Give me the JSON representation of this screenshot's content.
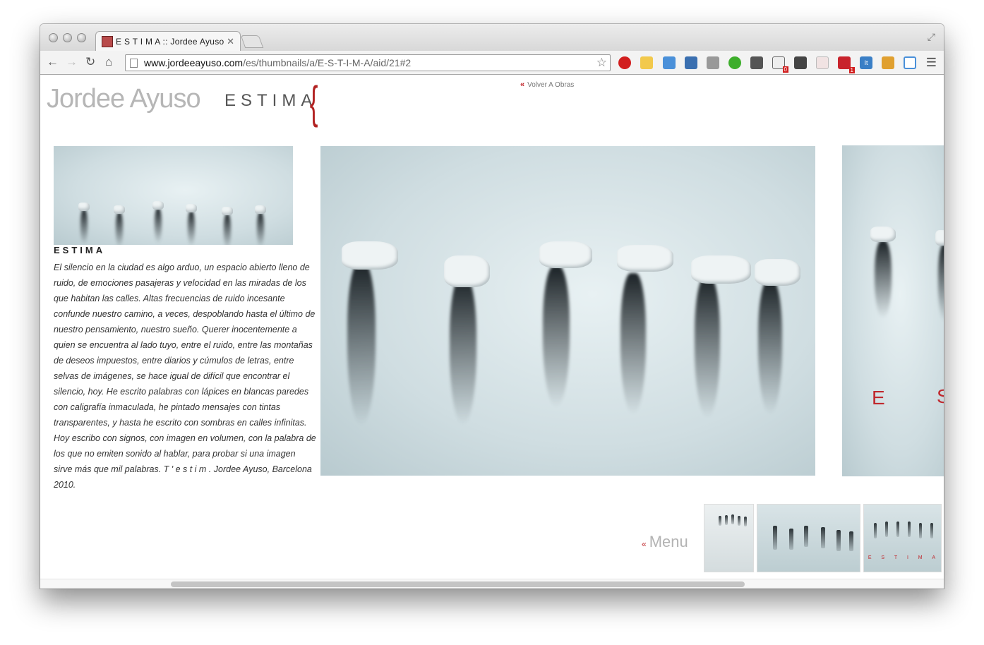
{
  "browser": {
    "tab_title": "E S T I M A :: Jordee Ayuso ::",
    "url_host": "www.jordeeayuso.com",
    "url_path": "/es/thumbnails/a/E-S-T-I-M-A/aid/21#2",
    "extension_badges": {
      "badge_a": "0",
      "badge_b": "1"
    },
    "extension_label_it": "It"
  },
  "site": {
    "logo": "Jordee Ayuso",
    "section_title": "ESTIMA",
    "back_link": "Volver A Obras",
    "menu_link": "Menu"
  },
  "artwork": {
    "title": "ESTIMA",
    "description": "El silencio en la ciudad es algo arduo, un espacio abierto lleno de ruido, de emociones pasajeras y velocidad en las miradas de los que habitan las calles. Altas frecuencias de ruido incesante confunde nuestro camino, a veces, despoblando hasta el último de nuestro pensamiento, nuestro sueño. Querer inocentemente a quien se encuentra al lado tuyo, entre el ruido, entre las montañas de deseos impuestos, entre diarios y cúmulos de letras, entre selvas de imágenes, se hace igual de difícil que encontrar el silencio, hoy. He escrito palabras con lápices en blancas paredes con caligrafía inmaculada, he pintado mensajes con tintas transparentes, y hasta he escrito con sombras en calles infinitas. Hoy escribo con signos, con imagen en volumen, con la palabra de los que no emiten sonido al hablar, para probar si una imagen sirve más que mil palabras. T ' e s t i m . Jordee Ayuso, Barcelona 2010.",
    "side_letters": [
      "E",
      "S"
    ],
    "thumb_letters": [
      "E",
      "S",
      "T",
      "I",
      "M",
      "A"
    ]
  },
  "colors": {
    "accent": "#c0282d",
    "logo_gray": "#b6b6b6"
  }
}
